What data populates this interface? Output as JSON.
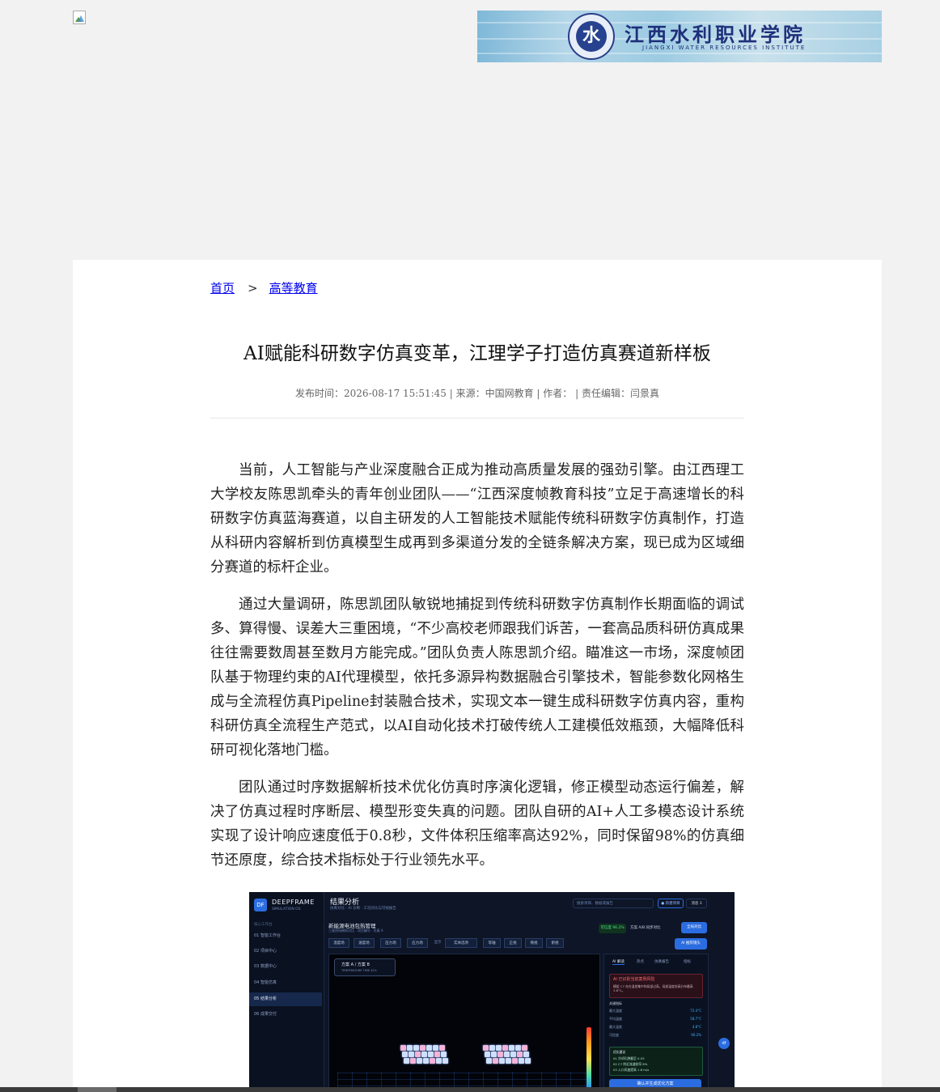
{
  "header": {
    "broken_image_icon": "broken-image-icon",
    "banner": {
      "school_name_cn": "江西水利职业学院",
      "school_name_en": "JIANGXI WATER RESOURCES INSTITUTE",
      "seal_glyph": "水"
    }
  },
  "breadcrumb": {
    "home": "首页",
    "separator": ">",
    "category": "高等教育"
  },
  "article": {
    "title": "AI赋能科研数字仿真变革，江理学子打造仿真赛道新样板",
    "meta": "发布时间：2026-08-17 15:51:45 | 来源：中国网教育 | 作者：  | 责任编辑：闫景真",
    "paragraphs": [
      "当前，人工智能与产业深度融合正成为推动高质量发展的强劲引擎。由江西理工大学校友陈思凯牵头的青年创业团队——“江西深度帧教育科技”立足于高速增长的科研数字仿真蓝海赛道，以自主研发的人工智能技术赋能传统科研数字仿真制作，打造从科研内容解析到仿真模型生成再到多渠道分发的全链条解决方案，现已成为区域细分赛道的标杆企业。",
      "通过大量调研，陈思凯团队敏锐地捕捉到传统科研数字仿真制作长期面临的调试多、算得慢、误差大三重困境，“不少高校老师跟我们诉苦，一套高品质科研仿真成果往往需要数周甚至数月方能完成。”团队负责人陈思凯介绍。瞄准这一市场，深度帧团队基于物理约束的AI代理模型，依托多源异构数据融合引擎技术，智能参数化网格生成与全流程仿真Pipeline封装融合技术，实现文本一键生成科研数字仿真内容，重构科研仿真全流程生产范式，以AI自动化技术打破传统人工建模低效瓶颈，大幅降低科研可视化落地门槛。",
      "团队通过时序数据解析技术优化仿真时序演化逻辑，修正模型动态运行偏差，解决了仿真过程时序断层、模型形变失真的问题。团队自研的AI+人工多模态设计系统实现了设计响应速度低于0.8秒，文件体积压缩率高达92%，同时保留98%的仿真细节还原度，综合技术指标处于行业领先水平。"
    ]
  },
  "figure": {
    "logo": "DF",
    "brand": "DEEPFRAME",
    "brand_sub": "SIMULATION OS",
    "nav_caption": "核心工作台",
    "nav": [
      "01  智能工作台",
      "02  项目中心",
      "03  数据中心",
      "04  智能仿真",
      "05  结果分析",
      "06  成果交付"
    ],
    "page_title": "结果分析",
    "page_sub": "仿真对比 · AI 诊断 · 工况对比与可视报告",
    "search_placeholder": "搜索项目、数据或报告",
    "top_button": "● 新建项目",
    "notify": "消息 3",
    "section_title": "新能源电池包热管理",
    "section_sub": "三维热场模拟对比 · 项目编号 · 仿真 A",
    "status_badge": "可信度 96.2%",
    "compare_label": "方案 A/B 同步对比",
    "run_button": "全局对比",
    "ai_button": "AI 推荐镜头",
    "tabs": [
      "温度场",
      "速度场",
      "压力场",
      "应力场",
      "实体选项",
      "等轴",
      "正视",
      "侧视",
      "俯视"
    ],
    "tab_prefix": "显示",
    "legend_title": "方案 A / 方案 B",
    "legend_sub": "TEMPERATURE    TIME 42%",
    "panel_tabs": [
      "AI 解读",
      "热点",
      "仿真报告",
      "指标"
    ],
    "alert_title": "AI 已识别当前案例风险",
    "alert_body": "模组 C7 存在温差集中和局部过高，局部温度较高分布最高 3.8°C。",
    "kpi_caption": "关键指标",
    "kpis": [
      {
        "label": "最大温度",
        "value": "72.4°C"
      },
      {
        "label": "平均温度",
        "value": "58.7°C"
      },
      {
        "label": "最大温差",
        "value": "4.8°C"
      },
      {
        "label": "可信度",
        "value": "96.2%"
      }
    ],
    "suggest_title": "优化建议",
    "suggestions": [
      "01  冷却孔隙翻至 0.53",
      "02  C7 附近流道收窄 8%",
      "03  入口风速提高 1.8 m/s"
    ],
    "cta": "确认并生成优化方案",
    "float_btn": "df"
  }
}
